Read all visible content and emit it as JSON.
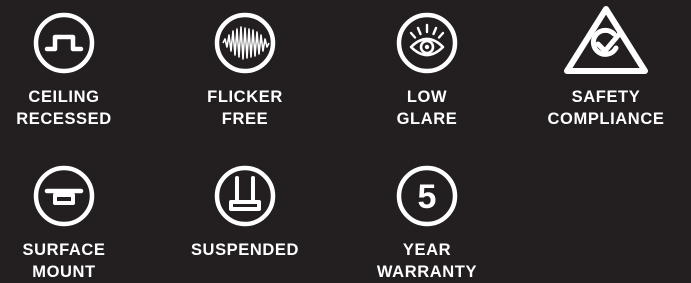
{
  "colors": {
    "background": "#231f20",
    "foreground": "#ffffff"
  },
  "features": [
    {
      "icon": "ceiling-recessed-icon",
      "line1": "CEILING",
      "line2": "RECESSED"
    },
    {
      "icon": "flicker-free-icon",
      "line1": "FLICKER",
      "line2": "FREE"
    },
    {
      "icon": "low-glare-eye-icon",
      "line1": "LOW",
      "line2": "GLARE"
    },
    {
      "icon": "safety-compliance-icon",
      "line1": "SAFETY",
      "line2": "COMPLIANCE"
    },
    {
      "icon": "surface-mount-icon",
      "line1": "SURFACE",
      "line2": "MOUNT"
    },
    {
      "icon": "suspended-icon",
      "line1": "SUSPENDED",
      "line2": ""
    },
    {
      "icon": "five-year-warranty-icon",
      "number": "5",
      "line1": "YEAR",
      "line2": "WARRANTY"
    }
  ]
}
